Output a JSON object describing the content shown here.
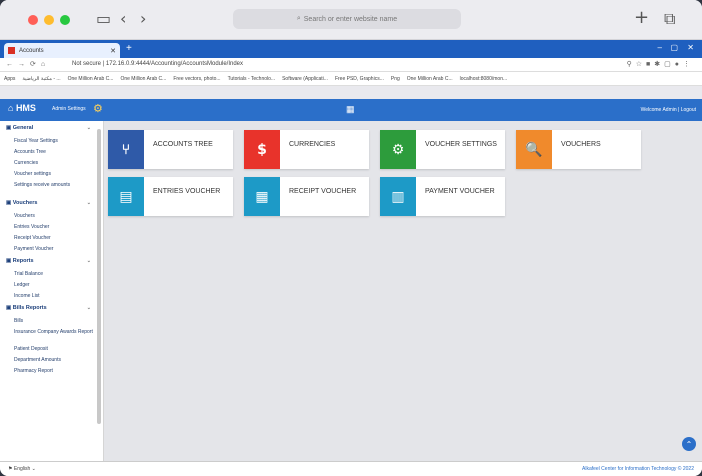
{
  "browser": {
    "search_placeholder": "Search or enter website name",
    "tab_title": "Accounts",
    "url_prefix": "Not secure",
    "url": "172.16.0.9:4444/Accounting/AccountsModule/Index",
    "bookmarks": [
      "Apps",
      "مكتبة الرياضية - ...",
      "One Million Arab C...",
      "One Million Arab C...",
      "Free vectors, photo...",
      "Tutorials - Technolo...",
      "Software (Applicati...",
      "Free PSD, Graphics...",
      "Png",
      "One Million Arab C...",
      "localhost:8080/mon..."
    ]
  },
  "appbar": {
    "logo": "HMS",
    "admin_settings": "Admin Settings",
    "welcome": "Welcome Admin | Logout"
  },
  "sidebar": {
    "sections": [
      {
        "title": "General",
        "items": [
          "Fiscal Year Settings",
          "Accounts Tree",
          "Currencies",
          "Voucher settings",
          "Settings receive amounts"
        ]
      },
      {
        "title": "Vouchers",
        "items": [
          "Vouchers",
          "Entries Voucher",
          "Receipt Voucher",
          "Payment Voucher"
        ]
      },
      {
        "title": "Reports",
        "items": [
          "Trial Balance",
          "Ledger",
          "Income List"
        ]
      },
      {
        "title": "Bills Reports",
        "items": [
          "Bills",
          "Insurance Company Awards Report",
          "Patient Deposit",
          "Department Amounts",
          "Pharmacy Report"
        ]
      }
    ]
  },
  "cards": [
    {
      "label": "ACCOUNTS TREE",
      "color": "#2f5aa8",
      "icon": "account-tree-icon",
      "glyph": "⑂"
    },
    {
      "label": "CURRENCIES",
      "color": "#e8332b",
      "icon": "dollar-icon",
      "glyph": "$"
    },
    {
      "label": "VOUCHER SETTINGS",
      "color": "#2d9c3c",
      "icon": "gears-icon",
      "glyph": "⚙"
    },
    {
      "label": "VOUCHERS",
      "color": "#f08a2c",
      "icon": "search-dollar-icon",
      "glyph": "🔍"
    },
    {
      "label": "ENTRIES VOUCHER",
      "color": "#1d9ac7",
      "icon": "document-icon",
      "glyph": "▤"
    },
    {
      "label": "RECEIPT VOUCHER",
      "color": "#1d9ac7",
      "icon": "receipt-icon",
      "glyph": "▦"
    },
    {
      "label": "PAYMENT VOUCHER",
      "color": "#1d9ac7",
      "icon": "invoice-icon",
      "glyph": "▥"
    }
  ],
  "status": {
    "language": "English",
    "copyright": "Alkafeel Center for Information Technology © 2022"
  }
}
